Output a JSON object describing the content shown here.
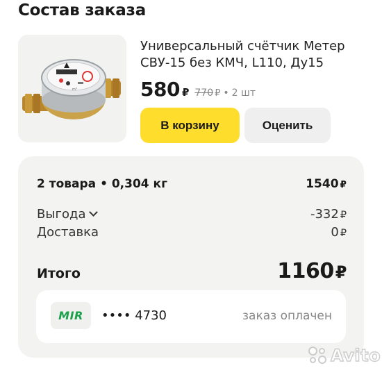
{
  "page": {
    "title": "Состав заказа"
  },
  "product": {
    "name": "Универсальный счётчик Метер СВУ-15 без КМЧ, L110, Ду15",
    "price": "580",
    "currency": "₽",
    "old_price": "770",
    "separator": "•",
    "quantity": "2 шт",
    "cart_button": "В корзину",
    "rate_button": "Оценить"
  },
  "summary": {
    "items_label": "2 товара • 0,304 кг",
    "items_value": "1540",
    "benefit_label": "Выгода",
    "benefit_value": "-332",
    "delivery_label": "Доставка",
    "delivery_value": "0",
    "total_label": "Итого",
    "total_value": "1160",
    "currency": "₽"
  },
  "payment": {
    "system": "MIR",
    "card_number": "•••• 4730",
    "status": "заказ оплачен"
  },
  "watermark": {
    "text": "Avito"
  },
  "colors": {
    "cart_button": "#ffdd2d",
    "mir_green": "#1aa04a",
    "summary_bg": "#f3f3f1"
  }
}
